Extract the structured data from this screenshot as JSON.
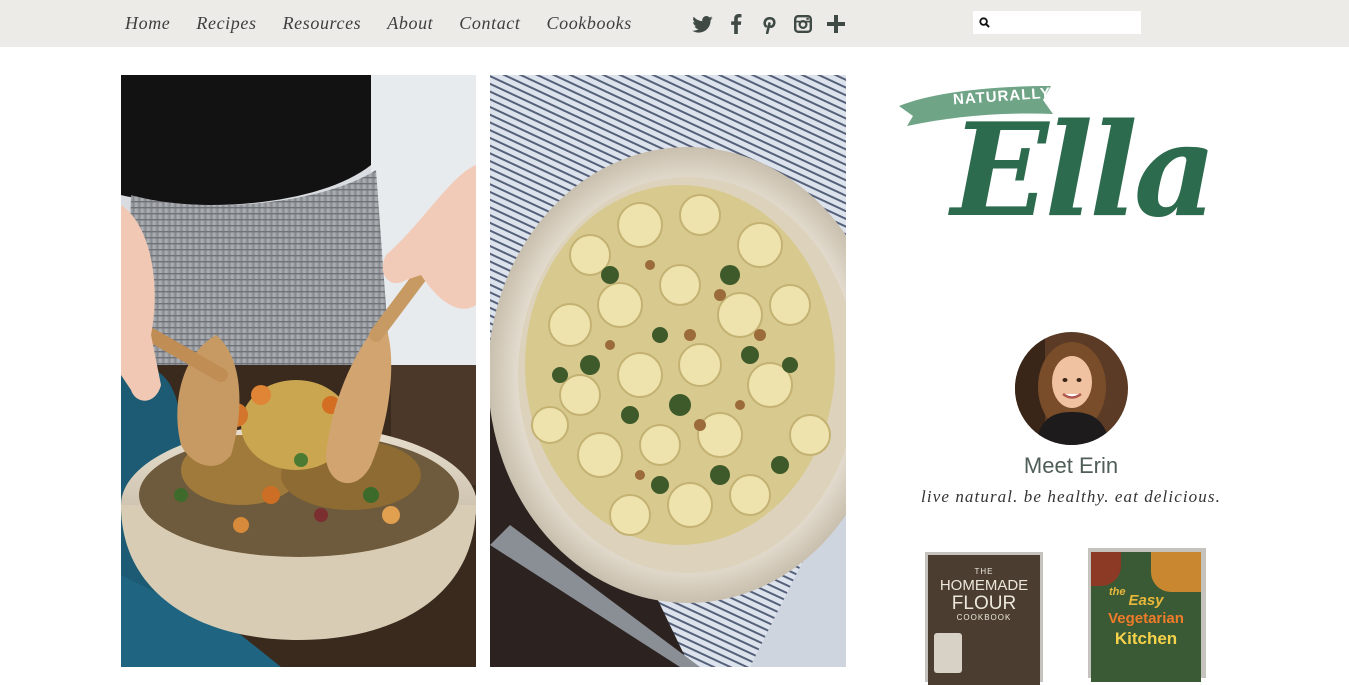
{
  "nav": {
    "items": [
      {
        "label": "Home"
      },
      {
        "label": "Recipes"
      },
      {
        "label": "Resources"
      },
      {
        "label": "About"
      },
      {
        "label": "Contact"
      },
      {
        "label": "Cookbooks"
      }
    ]
  },
  "social": {
    "icons": [
      "twitter-icon",
      "facebook-icon",
      "pinterest-icon",
      "instagram-icon",
      "plus-icon"
    ]
  },
  "search": {
    "value": "",
    "placeholder": ""
  },
  "logo": {
    "banner": "NATURALLY",
    "script": "Ella"
  },
  "sidebar": {
    "meet": "Meet Erin",
    "tagline": "live natural. be healthy. eat delicious."
  },
  "books": [
    {
      "top": "THE",
      "title1": "HOMEMADE",
      "title2": "FLOUR",
      "subtitle": "COOKBOOK"
    },
    {
      "the": "the",
      "title1": "Easy",
      "title2": "Vegetarian",
      "title3": "Kitchen"
    }
  ],
  "colors": {
    "topbar": "#ecebe8",
    "brand_green": "#2c6b4d",
    "banner_green": "#6fa487"
  }
}
